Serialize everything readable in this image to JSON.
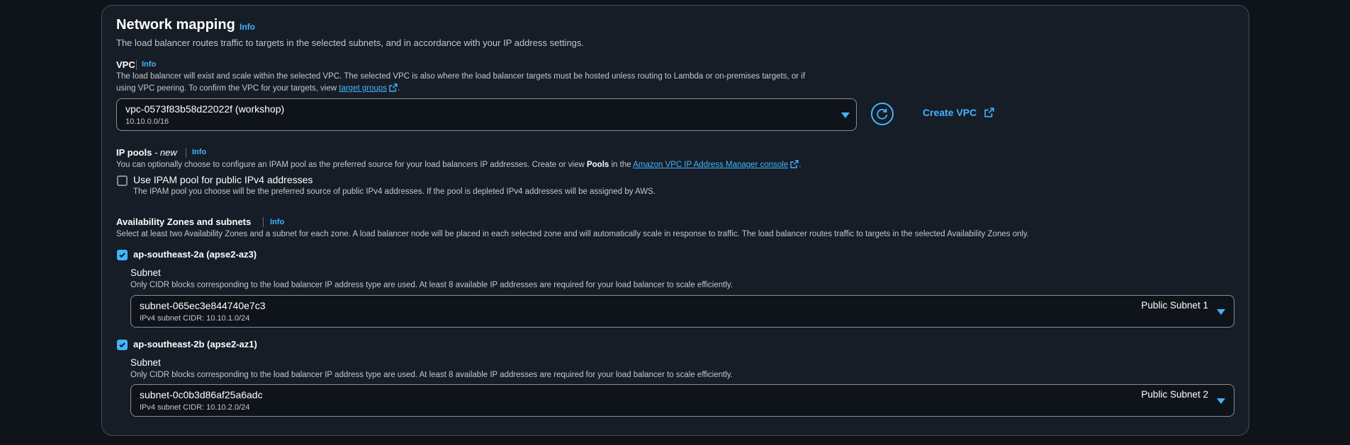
{
  "section": {
    "title": "Network mapping",
    "info": "Info",
    "description": "The load balancer routes traffic to targets in the selected subnets, and in accordance with your IP address settings."
  },
  "vpc": {
    "label": "VPC",
    "info": "Info",
    "description_1": "The load balancer will exist and scale within the selected VPC. The selected VPC is also where the load balancer targets must be hosted unless routing to Lambda or on-premises targets, or if",
    "description_2_prefix": "using VPC peering. To confirm the VPC for your targets, view ",
    "description_link": "target groups",
    "description_2_suffix": ".",
    "selected_value": "vpc-0573f83b58d22022f (workshop)",
    "selected_cidr": "10.10.0.0/16",
    "refresh_icon": "refresh-icon",
    "create_button": "Create VPC"
  },
  "ip_pools": {
    "label": "IP pools",
    "label_suffix": " - new",
    "info": "Info",
    "description_prefix": "You can optionally choose to configure an IPAM pool as the preferred source for your load balancers IP addresses. Create or view ",
    "description_bold": "Pools",
    "description_mid": " in the ",
    "description_link": "Amazon VPC IP Address Manager console",
    "description_suffix": ".",
    "checkbox_label": "Use IPAM pool for public IPv4 addresses",
    "checkbox_checked": false,
    "checkbox_description": "The IPAM pool you choose will be the preferred source of public IPv4 addresses. If the pool is depleted IPv4 addresses will be assigned by AWS."
  },
  "az": {
    "label": "Availability Zones and subnets",
    "info": "Info",
    "description": "Select at least two Availability Zones and a subnet for each zone. A load balancer node will be placed in each selected zone and will automatically scale in response to traffic. The load balancer routes traffic to targets in the selected Availability Zones only.",
    "zones": [
      {
        "name": "ap-southeast-2a (apse2-az3)",
        "checked": true,
        "subnet_label": "Subnet",
        "subnet_description": "Only CIDR blocks corresponding to the load balancer IP address type are used. At least 8 available IP addresses are required for your load balancer to scale efficiently.",
        "subnet_id": "subnet-065ec3e844740e7c3",
        "subnet_cidr": "IPv4 subnet CIDR: 10.10.1.0/24",
        "subnet_name": "Public Subnet 1"
      },
      {
        "name": "ap-southeast-2b (apse2-az1)",
        "checked": true,
        "subnet_label": "Subnet",
        "subnet_description": "Only CIDR blocks corresponding to the load balancer IP address type are used. At least 8 available IP addresses are required for your load balancer to scale efficiently.",
        "subnet_id": "subnet-0c0b3d86af25a6adc",
        "subnet_cidr": "IPv4 subnet CIDR: 10.10.2.0/24",
        "subnet_name": "Public Subnet 2"
      }
    ]
  },
  "colors": {
    "accent": "#42b4ff",
    "panel_bg": "#161d26",
    "page_bg": "#0f141a",
    "border": "#414d5c"
  }
}
